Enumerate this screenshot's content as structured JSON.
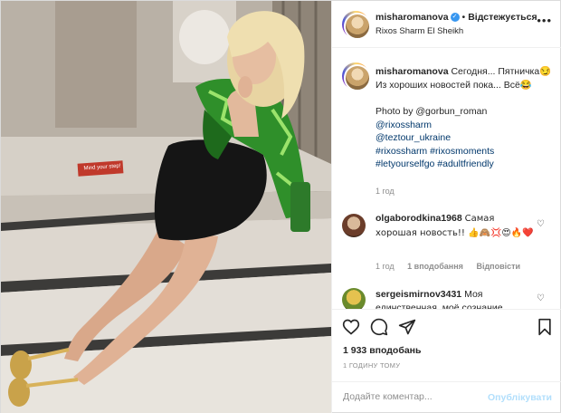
{
  "header": {
    "username": "misharomanova",
    "verified_mark": "✓",
    "separator": "•",
    "follow_status": "Відстежується",
    "location": "Rixos Sharm El Sheikh",
    "more": "•••"
  },
  "photo": {
    "sign_text": "Mind your step!"
  },
  "caption": {
    "username": "misharomanova",
    "text": "Сегодня... Пятничка😏Из хороших новостей пока... Всё😂",
    "photo_by": "Photo by @gorbun_roman",
    "links": [
      "@rixossharm",
      "@teztour_ukraine",
      "#rixossharm #rixosmoments",
      "#letyourselfgo #adultfriendly"
    ],
    "time": "1 год"
  },
  "comments": [
    {
      "username": "olgaborodkina1968",
      "text": "Самая хорошая новость!! 👍🙈💢😍🔥❤️",
      "time": "1 год",
      "likes": "1 вподобання",
      "reply": "Відповісти"
    },
    {
      "username": "sergeismirnov3431",
      "text": "Моя единственная, моё сознание"
    }
  ],
  "actions": {
    "icons": [
      "heart-icon",
      "comment-icon",
      "share-icon",
      "bookmark-icon"
    ]
  },
  "likes_count": "1 933 вподобань",
  "post_time": "1 ГОДИНУ ТОМУ",
  "add_comment": {
    "placeholder": "Додайте коментар...",
    "publish_label": "Опублікувати"
  },
  "colors": {
    "link": "#00376b",
    "muted": "#8e8e8e",
    "publish_disabled": "#b2dffc",
    "verified": "#3897f0"
  }
}
